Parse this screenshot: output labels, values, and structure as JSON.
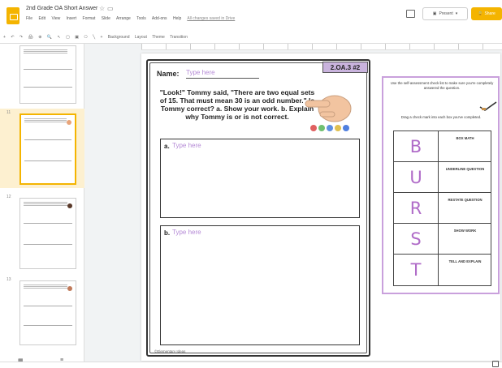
{
  "app": {
    "doc_title": "2nd Grade OA Short Answer",
    "menu": [
      "File",
      "Edit",
      "View",
      "Insert",
      "Format",
      "Slide",
      "Arrange",
      "Tools",
      "Add-ons",
      "Help"
    ],
    "save_status": "All changes saved in Drive",
    "present_label": "Present",
    "share_label": "Share"
  },
  "toolbar": {
    "items": [
      "+",
      "↶",
      "↷",
      "🖨",
      "⊕",
      "🔍",
      "↖",
      "▢",
      "▣",
      "⎔",
      "╲",
      "+",
      "Background",
      "Layout",
      "Theme",
      "Transition"
    ]
  },
  "filmstrip": {
    "slides": [
      {
        "num": ""
      },
      {
        "num": "11"
      },
      {
        "num": "12"
      },
      {
        "num": "13"
      }
    ]
  },
  "worksheet": {
    "standard": "2.OA.3 #2",
    "name_label": "Name:",
    "name_placeholder": "Type here",
    "question": "\"Look!\" Tommy said, \"There are two equal sets of 15. That must mean 30 is an odd number.\" Is Tommy correct? a. Show your work. b. Explain why Tommy is or is not correct.",
    "answer_a_label": "a.",
    "answer_a_placeholder": "Type here",
    "answer_b_label": "b.",
    "answer_b_placeholder": "Type here",
    "copyright": "©Elementary Ideas"
  },
  "burst": {
    "instruction": "Use the self-assessment check list to make sure you're completely answered the question.",
    "drag_instruction": "Drag a check mark into each box you've completed.",
    "rows": [
      {
        "letter": "B",
        "text": "BOX MATH"
      },
      {
        "letter": "U",
        "text": "UNDERLINE QUESTION"
      },
      {
        "letter": "R",
        "text": "RESTATE QUESTION"
      },
      {
        "letter": "S",
        "text": "SHOW WORK"
      },
      {
        "letter": "T",
        "text": "TELL AND EXPLAIN"
      }
    ]
  },
  "colors": {
    "accent": "#f4b400",
    "placeholder": "#b58ad6",
    "burst_letter": "#b06cc8",
    "badge": "#c9b3dd"
  }
}
